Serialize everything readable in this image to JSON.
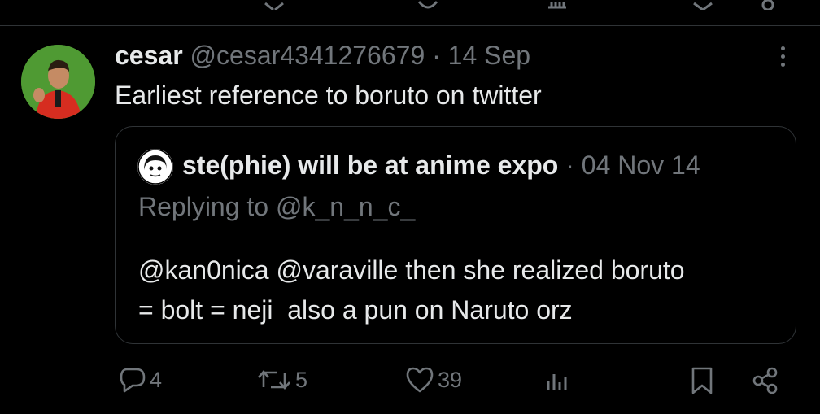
{
  "tweet": {
    "author_name": "cesar",
    "handle": "@cesar4341276679",
    "separator": "·",
    "date": "14 Sep",
    "text": "Earliest reference to boruto on twitter"
  },
  "quote": {
    "author_name": "ste(phie) will be at anime expo",
    "separator": "·",
    "date": "04 Nov 14",
    "replying_to": "Replying to @k_n_n_c_",
    "text_line1": "@kan0nica @varaville then she realized boruto",
    "text_line2": "= bolt = neji  also a pun on Naruto orz"
  },
  "actions": {
    "replies": "4",
    "reposts": "5",
    "likes": "39"
  },
  "colors": {
    "background": "#000000",
    "text_primary": "#e7e9ea",
    "text_secondary": "#71767b",
    "border": "#2f3336"
  }
}
